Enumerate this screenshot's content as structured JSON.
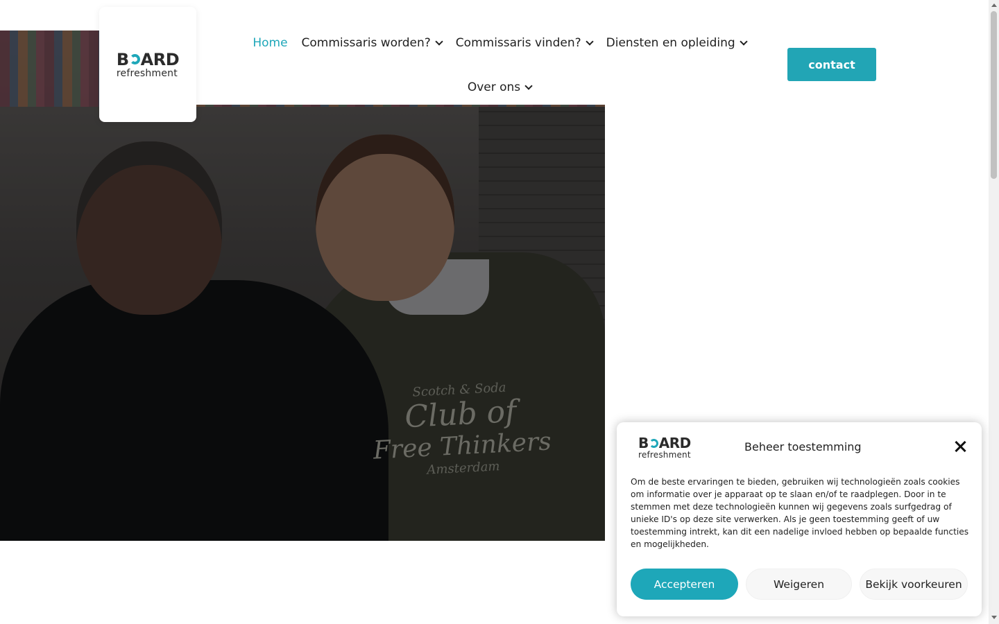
{
  "logo": {
    "word": "BOARD",
    "word_parts": [
      "B",
      "ARD"
    ],
    "sub": "refreshment"
  },
  "nav": {
    "items": [
      {
        "label": "Home",
        "active": true,
        "has_dropdown": false
      },
      {
        "label": "Commissaris worden?",
        "active": false,
        "has_dropdown": true
      },
      {
        "label": "Commissaris vinden?",
        "active": false,
        "has_dropdown": true
      },
      {
        "label": "Diensten en opleiding",
        "active": false,
        "has_dropdown": true
      },
      {
        "label": "Over ons",
        "active": false,
        "has_dropdown": true
      }
    ]
  },
  "header": {
    "contact_label": "contact"
  },
  "hero": {
    "shirt_text": [
      "Scotch & Soda",
      "Club of",
      "Free Thinkers",
      "Amsterdam"
    ]
  },
  "cookie": {
    "title": "Beheer toestemming",
    "body": "Om de beste ervaringen te bieden, gebruiken wij technologieën zoals cookies om informatie over je apparaat op te slaan en/of te raadplegen. Door in te stemmen met deze technologieën kunnen wij gegevens zoals surfgedrag of unieke ID's op deze site verwerken. Als je geen toestemming geeft of uw toestemming intrekt, kan dit een nadelige invloed hebben op bepaalde functies en mogelijkheden.",
    "accept_label": "Accepteren",
    "deny_label": "Weigeren",
    "prefs_label": "Bekijk voorkeuren"
  },
  "colors": {
    "accent": "#1ea7b9",
    "contact_button": "#22a5b5",
    "text": "#1f1f1f"
  },
  "icons": [
    "chevron-down-icon",
    "close-icon",
    "logo-ring-icon"
  ]
}
